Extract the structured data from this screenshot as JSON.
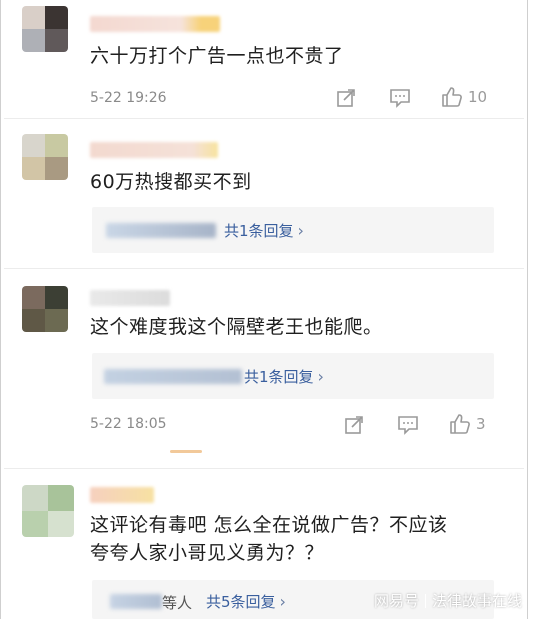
{
  "comments": [
    {
      "text": "六十万打个广告一点也不贵了",
      "time": "5-22 19:26",
      "likes": "10"
    },
    {
      "text": "60万热搜都买不到",
      "reply_label": "共1条回复"
    },
    {
      "text": "这个难度我这个隔壁老王也能爬。",
      "reply_label": "共1条回复",
      "time": "5-22 18:05",
      "likes": "3"
    },
    {
      "text_line1": "这评论有毒吧 怎么全在说做广告？不应该",
      "text_line2": "夸夸人家小哥见义勇为？？",
      "reply_prefix": "等人",
      "reply_label": "共5条回复"
    }
  ],
  "icons": {
    "share": "share-icon",
    "comment": "comment-icon",
    "like": "thumbs-up-icon",
    "chevron": "chevron-right-icon"
  },
  "watermark": {
    "brand": "网易号",
    "account": "法律故事在线"
  },
  "colors": {
    "link": "#3a5f9e",
    "meta": "#8a8a8a",
    "reply_bg": "#f5f5f5"
  }
}
